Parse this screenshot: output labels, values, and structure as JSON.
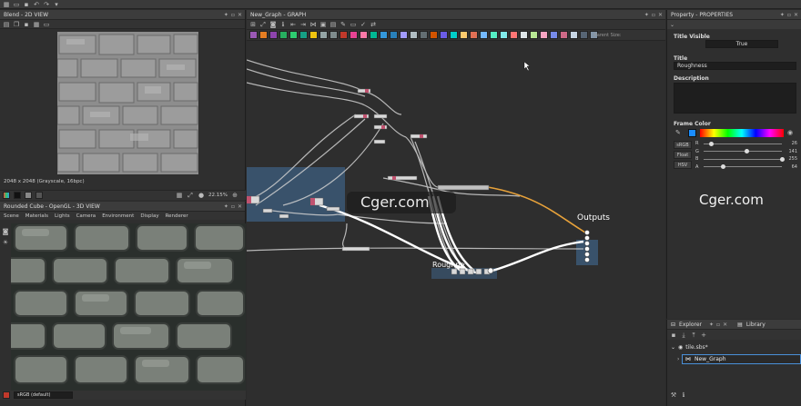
{
  "topbar": {
    "icons": [
      "grid-icon",
      "file-icon",
      "save-icon",
      "undo-icon",
      "redo-icon",
      "dropdown-icon"
    ]
  },
  "view2d": {
    "title": "Blend - 2D VIEW",
    "info": "2048 x 2048 (Grayscale, 16bpc)",
    "zoom": "22.15%"
  },
  "view3d": {
    "title": "Rounded Cube - OpenGL - 3D VIEW",
    "menu": [
      "Scene",
      "Materials",
      "Lights",
      "Camera",
      "Environment",
      "Display",
      "Renderer"
    ],
    "colorspace": "sRGB (default)"
  },
  "graph": {
    "title": "New_Graph - GRAPH",
    "parent_size_label": "Parent Size:",
    "outputs_label": "Outputs",
    "frame_label": "Roughness",
    "palette_colors": [
      "#9b59b6",
      "#e67e22",
      "#8e44ad",
      "#27ae60",
      "#2ecc71",
      "#16a085",
      "#f1c40f",
      "#95a5a6",
      "#7f8c8d",
      "#c0392b",
      "#e84393",
      "#fd79a8",
      "#00b894",
      "#3498db",
      "#2980b9",
      "#a29bfe",
      "#b2bec3",
      "#636e72",
      "#d35400",
      "#6c5ce7",
      "#00cec9",
      "#fdcb6e",
      "#e17055",
      "#74b9ff",
      "#55efc4",
      "#81ecec",
      "#ff7675",
      "#dfe6e9",
      "#b8e994",
      "#f8a5c2",
      "#778beb",
      "#cf6a87",
      "#c8d6e5",
      "#576574",
      "#8395a7"
    ]
  },
  "properties": {
    "title": "Property - PROPERTIES",
    "title_visible_label": "Title Visible",
    "title_visible_value": "True",
    "title_label": "Title",
    "title_value": "Roughness",
    "description_label": "Description",
    "frame_color_label": "Frame Color",
    "modes": [
      "sRGB",
      "Float",
      "HSV"
    ],
    "channels": [
      {
        "name": "R",
        "value": "26",
        "fraction": 0.1
      },
      {
        "name": "G",
        "value": "141",
        "fraction": 0.55
      },
      {
        "name": "B",
        "value": "255",
        "fraction": 1.0
      },
      {
        "name": "A",
        "value": "64",
        "fraction": 0.25
      }
    ],
    "frame_color": "#1a8dff"
  },
  "explorer": {
    "tab_explorer": "Explorer",
    "tab_library": "Library",
    "package": "tile.sbs*",
    "graph_item": "New_Graph"
  },
  "watermark": "Cger.com"
}
